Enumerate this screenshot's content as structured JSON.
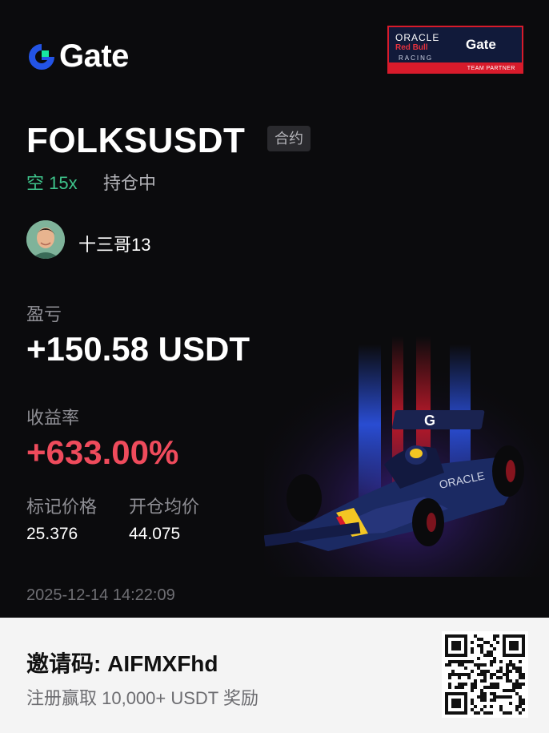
{
  "brand": {
    "name": "Gate",
    "color_blue": "#2354e6",
    "color_green": "#17e6a1"
  },
  "partner_badge": {
    "oracle": "ORACLE",
    "redbull": "Red Bull",
    "racing": "RACING",
    "gate": "Gate",
    "subtitle": "TEAM PARTNER"
  },
  "position": {
    "pair": "FOLKSUSDT",
    "type_tag": "合约",
    "direction": "空 15x",
    "status": "持仓中"
  },
  "user": {
    "name": "十三哥13"
  },
  "pnl": {
    "label": "盈亏",
    "value": "+150.58 USDT"
  },
  "roe": {
    "label": "收益率",
    "value": "+633.00%"
  },
  "prices": {
    "mark_label": "标记价格",
    "mark_value": "25.376",
    "entry_label": "开仓均价",
    "entry_value": "44.075"
  },
  "timestamp": "2025-12-14 14:22:09",
  "footer": {
    "invite_text": "邀请码: AIFMXFhd",
    "promo_text": "注册赢取 10,000+ USDT 奖励"
  },
  "colors": {
    "profit": "#ef4b5c",
    "short": "#3ec48b",
    "background": "#0b0b0d"
  },
  "icons": {
    "logo": "gate-logo-icon",
    "qr": "qr-code-icon"
  }
}
